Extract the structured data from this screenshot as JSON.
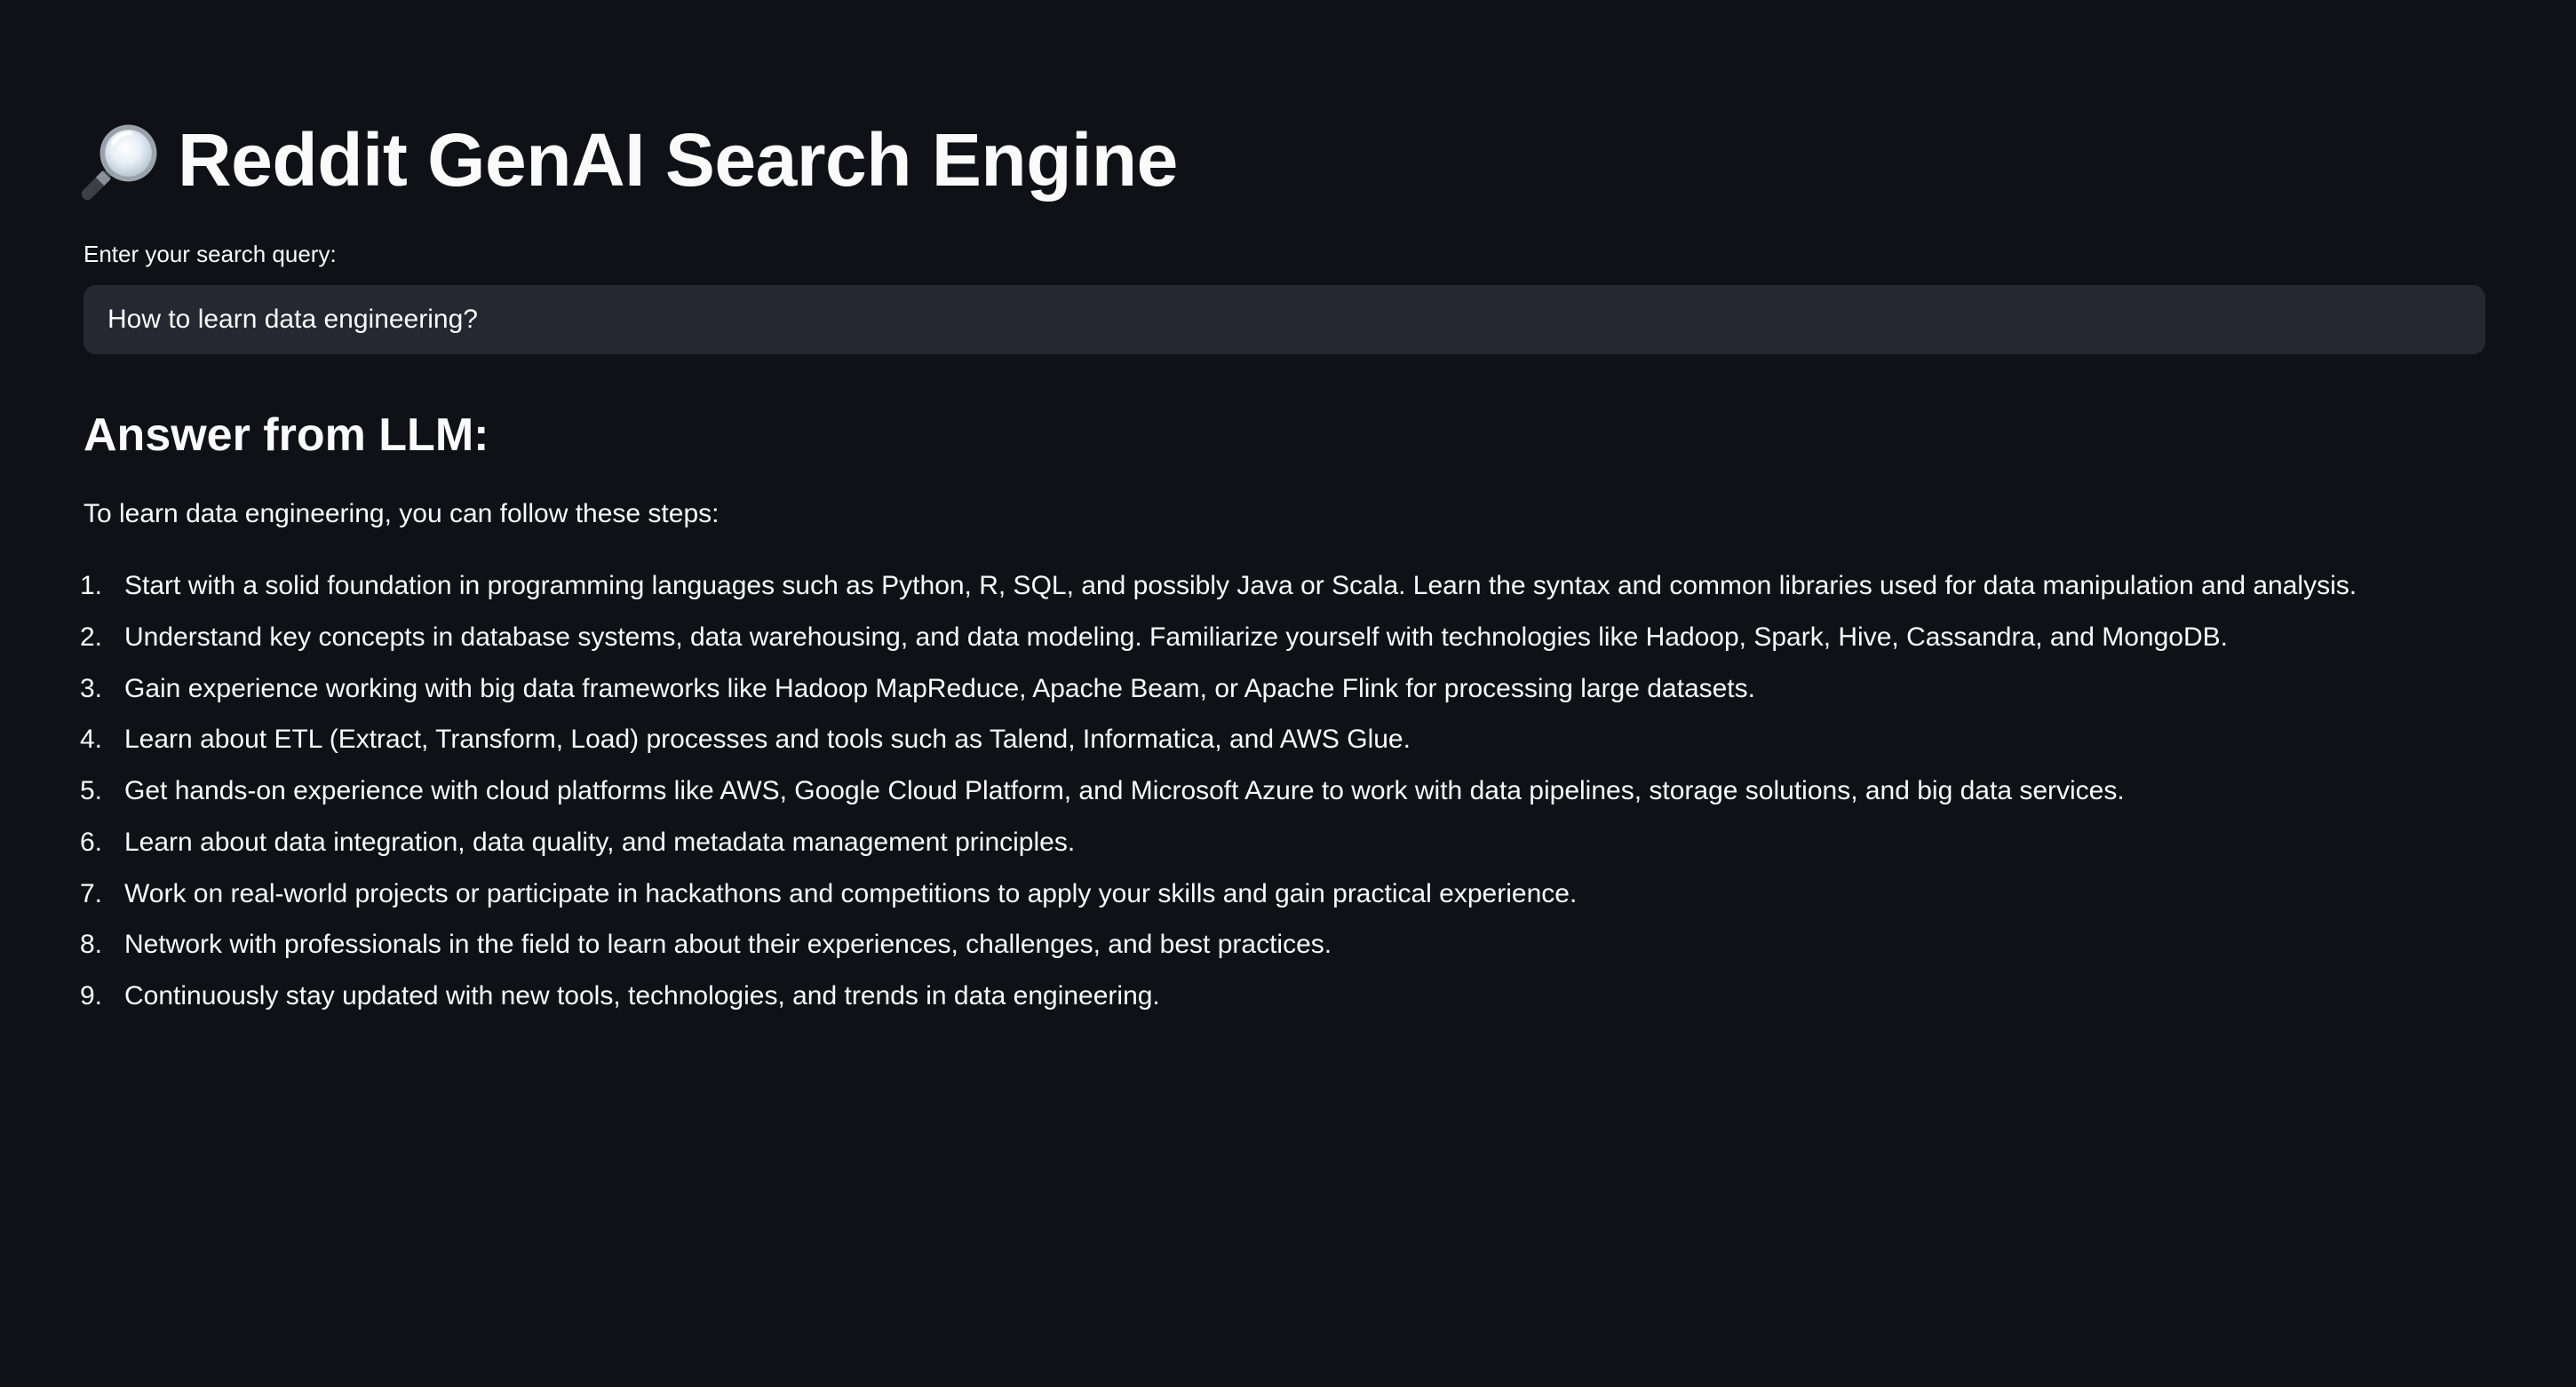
{
  "header": {
    "icon": "magnifying-glass-icon",
    "title": "Reddit GenAI Search Engine"
  },
  "search": {
    "label": "Enter your search query:",
    "value": "How to learn data engineering?"
  },
  "answer": {
    "heading": "Answer from LLM:",
    "intro": "To learn data engineering, you can follow these steps:",
    "steps": [
      {
        "num": "1.",
        "text": "Start with a solid foundation in programming languages such as Python, R, SQL, and possibly Java or Scala. Learn the syntax and common libraries used for data manipulation and analysis."
      },
      {
        "num": "2.",
        "text": "Understand key concepts in database systems, data warehousing, and data modeling. Familiarize yourself with technologies like Hadoop, Spark, Hive, Cassandra, and MongoDB."
      },
      {
        "num": "3.",
        "text": "Gain experience working with big data frameworks like Hadoop MapReduce, Apache Beam, or Apache Flink for processing large datasets."
      },
      {
        "num": "4.",
        "text": "Learn about ETL (Extract, Transform, Load) processes and tools such as Talend, Informatica, and AWS Glue."
      },
      {
        "num": "5.",
        "text": "Get hands-on experience with cloud platforms like AWS, Google Cloud Platform, and Microsoft Azure to work with data pipelines, storage solutions, and big data services."
      },
      {
        "num": "6.",
        "text": "Learn about data integration, data quality, and metadata management principles."
      },
      {
        "num": "7.",
        "text": "Work on real-world projects or participate in hackathons and competitions to apply your skills and gain practical experience."
      },
      {
        "num": "8.",
        "text": "Network with professionals in the field to learn about their experiences, challenges, and best practices."
      },
      {
        "num": "9.",
        "text": "Continuously stay updated with new tools, technologies, and trends in data engineering."
      }
    ]
  },
  "colors": {
    "background": "#0f1116",
    "text": "#fafafa",
    "input_background": "#262730"
  }
}
